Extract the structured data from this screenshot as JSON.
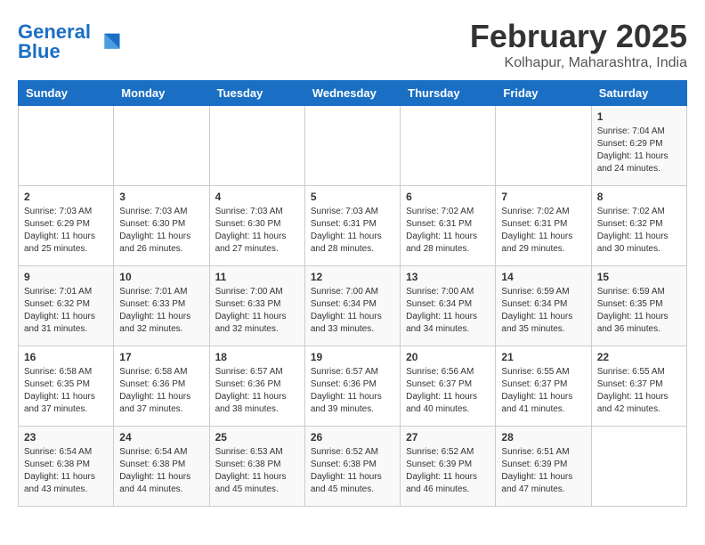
{
  "header": {
    "logo_general": "General",
    "logo_blue": "Blue",
    "month_year": "February 2025",
    "location": "Kolhapur, Maharashtra, India"
  },
  "days_of_week": [
    "Sunday",
    "Monday",
    "Tuesday",
    "Wednesday",
    "Thursday",
    "Friday",
    "Saturday"
  ],
  "weeks": [
    [
      {
        "day": "",
        "info": ""
      },
      {
        "day": "",
        "info": ""
      },
      {
        "day": "",
        "info": ""
      },
      {
        "day": "",
        "info": ""
      },
      {
        "day": "",
        "info": ""
      },
      {
        "day": "",
        "info": ""
      },
      {
        "day": "1",
        "info": "Sunrise: 7:04 AM\nSunset: 6:29 PM\nDaylight: 11 hours and 24 minutes."
      }
    ],
    [
      {
        "day": "2",
        "info": "Sunrise: 7:03 AM\nSunset: 6:29 PM\nDaylight: 11 hours and 25 minutes."
      },
      {
        "day": "3",
        "info": "Sunrise: 7:03 AM\nSunset: 6:30 PM\nDaylight: 11 hours and 26 minutes."
      },
      {
        "day": "4",
        "info": "Sunrise: 7:03 AM\nSunset: 6:30 PM\nDaylight: 11 hours and 27 minutes."
      },
      {
        "day": "5",
        "info": "Sunrise: 7:03 AM\nSunset: 6:31 PM\nDaylight: 11 hours and 28 minutes."
      },
      {
        "day": "6",
        "info": "Sunrise: 7:02 AM\nSunset: 6:31 PM\nDaylight: 11 hours and 28 minutes."
      },
      {
        "day": "7",
        "info": "Sunrise: 7:02 AM\nSunset: 6:31 PM\nDaylight: 11 hours and 29 minutes."
      },
      {
        "day": "8",
        "info": "Sunrise: 7:02 AM\nSunset: 6:32 PM\nDaylight: 11 hours and 30 minutes."
      }
    ],
    [
      {
        "day": "9",
        "info": "Sunrise: 7:01 AM\nSunset: 6:32 PM\nDaylight: 11 hours and 31 minutes."
      },
      {
        "day": "10",
        "info": "Sunrise: 7:01 AM\nSunset: 6:33 PM\nDaylight: 11 hours and 32 minutes."
      },
      {
        "day": "11",
        "info": "Sunrise: 7:00 AM\nSunset: 6:33 PM\nDaylight: 11 hours and 32 minutes."
      },
      {
        "day": "12",
        "info": "Sunrise: 7:00 AM\nSunset: 6:34 PM\nDaylight: 11 hours and 33 minutes."
      },
      {
        "day": "13",
        "info": "Sunrise: 7:00 AM\nSunset: 6:34 PM\nDaylight: 11 hours and 34 minutes."
      },
      {
        "day": "14",
        "info": "Sunrise: 6:59 AM\nSunset: 6:34 PM\nDaylight: 11 hours and 35 minutes."
      },
      {
        "day": "15",
        "info": "Sunrise: 6:59 AM\nSunset: 6:35 PM\nDaylight: 11 hours and 36 minutes."
      }
    ],
    [
      {
        "day": "16",
        "info": "Sunrise: 6:58 AM\nSunset: 6:35 PM\nDaylight: 11 hours and 37 minutes."
      },
      {
        "day": "17",
        "info": "Sunrise: 6:58 AM\nSunset: 6:36 PM\nDaylight: 11 hours and 37 minutes."
      },
      {
        "day": "18",
        "info": "Sunrise: 6:57 AM\nSunset: 6:36 PM\nDaylight: 11 hours and 38 minutes."
      },
      {
        "day": "19",
        "info": "Sunrise: 6:57 AM\nSunset: 6:36 PM\nDaylight: 11 hours and 39 minutes."
      },
      {
        "day": "20",
        "info": "Sunrise: 6:56 AM\nSunset: 6:37 PM\nDaylight: 11 hours and 40 minutes."
      },
      {
        "day": "21",
        "info": "Sunrise: 6:55 AM\nSunset: 6:37 PM\nDaylight: 11 hours and 41 minutes."
      },
      {
        "day": "22",
        "info": "Sunrise: 6:55 AM\nSunset: 6:37 PM\nDaylight: 11 hours and 42 minutes."
      }
    ],
    [
      {
        "day": "23",
        "info": "Sunrise: 6:54 AM\nSunset: 6:38 PM\nDaylight: 11 hours and 43 minutes."
      },
      {
        "day": "24",
        "info": "Sunrise: 6:54 AM\nSunset: 6:38 PM\nDaylight: 11 hours and 44 minutes."
      },
      {
        "day": "25",
        "info": "Sunrise: 6:53 AM\nSunset: 6:38 PM\nDaylight: 11 hours and 45 minutes."
      },
      {
        "day": "26",
        "info": "Sunrise: 6:52 AM\nSunset: 6:38 PM\nDaylight: 11 hours and 45 minutes."
      },
      {
        "day": "27",
        "info": "Sunrise: 6:52 AM\nSunset: 6:39 PM\nDaylight: 11 hours and 46 minutes."
      },
      {
        "day": "28",
        "info": "Sunrise: 6:51 AM\nSunset: 6:39 PM\nDaylight: 11 hours and 47 minutes."
      },
      {
        "day": "",
        "info": ""
      }
    ]
  ]
}
